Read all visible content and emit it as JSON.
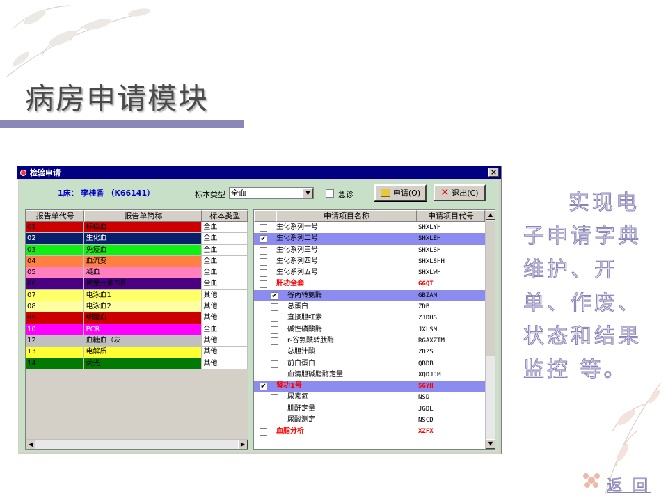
{
  "slide": {
    "title": "病房申请模块",
    "description": "实现电子申请字典维护、开单、作废、状态和结果监控 等。",
    "back_link": "返 回"
  },
  "dialog": {
    "title": "检验申请",
    "close_glyph": "×",
    "patient_info": "1床： 李桂香 （K66141）",
    "specimen_label": "标本类型",
    "specimen_value": "全血",
    "urgent_label": "急诊",
    "urgent_checked": false,
    "apply_button": "申请(O)",
    "exit_button": "退出(C)"
  },
  "left_table": {
    "headers": [
      "报告单代号",
      "报告单简称",
      "标本类型"
    ],
    "rows": [
      {
        "code": "01",
        "name": "标检血",
        "specimen": "全血",
        "color": "#cc0000",
        "text_color": "#000000"
      },
      {
        "code": "02",
        "name": "生化血",
        "specimen": "全血",
        "color": "#0a1f6b",
        "text_color": "#ffffff"
      },
      {
        "code": "03",
        "name": "免疫血",
        "specimen": "全血",
        "color": "#11ee11",
        "text_color": "#000000"
      },
      {
        "code": "04",
        "name": "血流变",
        "specimen": "全血",
        "color": "#ff8040",
        "text_color": "#000000"
      },
      {
        "code": "05",
        "name": "凝血",
        "specimen": "全血",
        "color": "#ff7fbf",
        "text_color": "#000000"
      },
      {
        "code": "06",
        "name": "微量元素7项",
        "specimen": "全血",
        "color": "#4b0082",
        "text_color": "#000000"
      },
      {
        "code": "07",
        "name": "电泳血1",
        "specimen": "其他",
        "color": "#ffff66",
        "text_color": "#000000"
      },
      {
        "code": "08",
        "name": "电泳血2",
        "specimen": "其他",
        "color": "#ffffa0",
        "text_color": "#000000"
      },
      {
        "code": "09",
        "name": "细菌血",
        "specimen": "其他",
        "color": "#cc0000",
        "text_color": "#000000"
      },
      {
        "code": "10",
        "name": "PCR",
        "specimen": "全血",
        "color": "#ff00ff",
        "text_color": "#ffffff"
      },
      {
        "code": "12",
        "name": "血糖血（灰",
        "specimen": "其他",
        "color": "#c0c0c0",
        "text_color": "#000000"
      },
      {
        "code": "13",
        "name": "电解质",
        "specimen": "其他",
        "color": "#ffff33",
        "text_color": "#000000"
      },
      {
        "code": "14",
        "name": "荧光",
        "specimen": "其他",
        "color": "#007a00",
        "text_color": "#000000"
      }
    ]
  },
  "right_table": {
    "headers": [
      "申请项目名称",
      "申请项目代号"
    ],
    "rows": [
      {
        "name": "生化系列一号",
        "code": "SHXLYH",
        "checked": false,
        "level": 0,
        "selected": false,
        "group": false
      },
      {
        "name": "生化系列二号",
        "code": "SHXLEH",
        "checked": true,
        "level": 0,
        "selected": true,
        "group": false
      },
      {
        "name": "生化系列三号",
        "code": "SHXLSH",
        "checked": false,
        "level": 0,
        "selected": false,
        "group": false
      },
      {
        "name": "生化系列四号",
        "code": "SHXLSHH",
        "checked": false,
        "level": 0,
        "selected": false,
        "group": false
      },
      {
        "name": "生化系列五号",
        "code": "SHXLWH",
        "checked": false,
        "level": 0,
        "selected": false,
        "group": false
      },
      {
        "name": "肝功全套",
        "code": "GGQT",
        "checked": false,
        "level": 0,
        "selected": false,
        "group": true
      },
      {
        "name": "谷丙转氨酶",
        "code": "GBZAM",
        "checked": true,
        "level": 1,
        "selected": true,
        "group": false
      },
      {
        "name": "总蛋白",
        "code": "ZDB",
        "checked": false,
        "level": 1,
        "selected": false,
        "group": false
      },
      {
        "name": "直接胆红素",
        "code": "ZJDHS",
        "checked": false,
        "level": 1,
        "selected": false,
        "group": false
      },
      {
        "name": "碱性磷酸酶",
        "code": "JXLSM",
        "checked": false,
        "level": 1,
        "selected": false,
        "group": false
      },
      {
        "name": "r-谷氨酰转肽酶",
        "code": "RGAXZTM",
        "checked": false,
        "level": 1,
        "selected": false,
        "group": false
      },
      {
        "name": "总胆汁酸",
        "code": "ZDZS",
        "checked": false,
        "level": 1,
        "selected": false,
        "group": false
      },
      {
        "name": "前白蛋白",
        "code": "QBDB",
        "checked": false,
        "level": 1,
        "selected": false,
        "group": false
      },
      {
        "name": "血清胆碱脂酶定量",
        "code": "XQDJJM",
        "checked": false,
        "level": 1,
        "selected": false,
        "group": false
      },
      {
        "name": "肾功1号",
        "code": "SGYH",
        "checked": true,
        "level": 0,
        "selected": true,
        "group": true
      },
      {
        "name": "尿素氮",
        "code": "NSD",
        "checked": false,
        "level": 1,
        "selected": false,
        "group": false
      },
      {
        "name": "肌酐定量",
        "code": "JGDL",
        "checked": false,
        "level": 1,
        "selected": false,
        "group": false
      },
      {
        "name": "尿酸测定",
        "code": "NSCD",
        "checked": false,
        "level": 1,
        "selected": false,
        "group": false
      },
      {
        "name": "血脂分析",
        "code": "XZFX",
        "checked": false,
        "level": 0,
        "selected": false,
        "group": true
      }
    ]
  },
  "icons": {
    "window": "app-icon",
    "close": "close-icon",
    "apply": "apply-icon",
    "exit": "exit-x-icon",
    "dropdown": "chevron-down-icon",
    "scroll_left": "arrow-left-icon",
    "scroll_right": "arrow-right-icon",
    "scroll_up": "arrow-up-icon",
    "scroll_down": "arrow-down-icon"
  }
}
